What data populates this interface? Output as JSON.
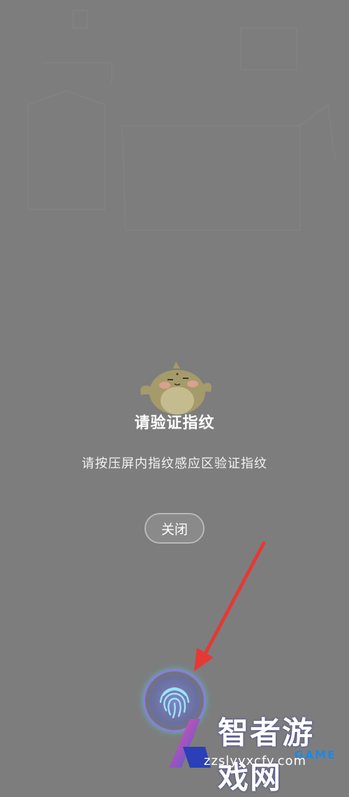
{
  "dialog": {
    "title": "请验证指纹",
    "message": "请按压屏内指纹感应区验证指纹",
    "close_label": "关闭"
  },
  "fingerprint": {
    "icon": "fingerprint-icon"
  },
  "watermark": {
    "title": "智者游戏网",
    "url": "zzslyyxcfy.com",
    "tag": "GAME"
  },
  "colors": {
    "background": "#7d7d7d",
    "arrow": "#e53935",
    "fingerprint_ring": "#8a7fd6"
  }
}
